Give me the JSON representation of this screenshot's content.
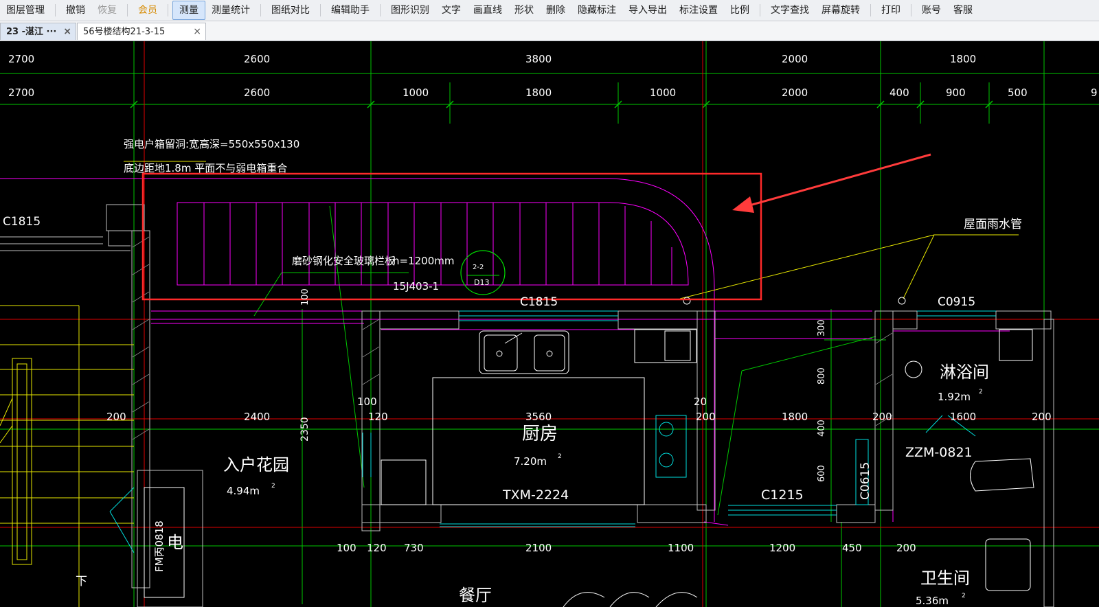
{
  "toolbar": {
    "items": [
      {
        "label": "图层管理",
        "state": "normal"
      },
      {
        "label": "撤销",
        "state": "normal"
      },
      {
        "label": "恢复",
        "state": "disabled"
      },
      {
        "label": "会员",
        "state": "vip"
      },
      {
        "label": "测量",
        "state": "active"
      },
      {
        "label": "测量统计",
        "state": "normal"
      },
      {
        "label": "图纸对比",
        "state": "normal"
      },
      {
        "label": "编辑助手",
        "state": "normal"
      },
      {
        "label": "图形识别",
        "state": "normal"
      },
      {
        "label": "文字",
        "state": "normal"
      },
      {
        "label": "画直线",
        "state": "normal"
      },
      {
        "label": "形状",
        "state": "normal"
      },
      {
        "label": "删除",
        "state": "normal"
      },
      {
        "label": "隐藏标注",
        "state": "normal"
      },
      {
        "label": "导入导出",
        "state": "normal"
      },
      {
        "label": "标注设置",
        "state": "normal"
      },
      {
        "label": "比例",
        "state": "normal"
      },
      {
        "label": "文字查找",
        "state": "normal"
      },
      {
        "label": "屏幕旋转",
        "state": "normal"
      },
      {
        "label": "打印",
        "state": "normal"
      },
      {
        "label": "账号",
        "state": "normal"
      },
      {
        "label": "客服",
        "state": "normal"
      }
    ]
  },
  "tabs": [
    {
      "label": "23 -湛江 ···",
      "close": "×"
    },
    {
      "label": "56号楼结构21-3-15",
      "close": "×"
    }
  ],
  "drawing": {
    "top_dims_row1": [
      "2700",
      "2600",
      "3800",
      "2000",
      "1800"
    ],
    "top_dims_row2": [
      "2700",
      "2600",
      "1000",
      "1800",
      "1000",
      "2000",
      "400",
      "900",
      "500",
      "9"
    ],
    "note_line1": "强电户箱留洞:宽高深=550x550x130",
    "note_line2": "底边距地1.8m   平面不与弱电箱重合",
    "railing_note": "磨砂钢化安全玻璃栏板",
    "railing_height": "h=1200mm",
    "railing_ref": "15J403-1",
    "detail_top": "2-2",
    "detail_bottom": "D13",
    "window_c1815_left": "C1815",
    "window_c1815_mid": "C1815",
    "window_c0915": "C0915",
    "rain_pipe": "屋面雨水管",
    "dim_100_vertical": "100",
    "dim_300": "300",
    "dim_800": "800",
    "dim_400": "400",
    "dim_600": "600",
    "mid_dims": [
      "200",
      "2400",
      "100",
      "120",
      "3560",
      "20",
      "200",
      "1800",
      "200",
      "1600",
      "200"
    ],
    "dim_2350": "2350",
    "garden_name": "入户花园",
    "garden_area": "4.94m",
    "kitchen_name": "厨房",
    "kitchen_area": "7.20m",
    "door_txm": "TXM-2224",
    "window_c1215": "C1215",
    "window_c0615": "C0615",
    "door_zzm": "ZZM-0821",
    "shower_name": "淋浴间",
    "shower_area": "1.92m",
    "bath_name": "卫生间",
    "bath_area": "5.36m",
    "sup": "2",
    "bottom_dims": [
      "100",
      "120",
      "730",
      "2100",
      "1100",
      "1200",
      "450",
      "200"
    ],
    "dining_name": "餐厅",
    "fm_label": "FM丙0818",
    "elec_label": "电",
    "down_label": "下"
  },
  "colors": {
    "grid_green": "#00ff00",
    "axis_red": "#ff0000",
    "magenta": "#ff00ff",
    "yellow": "#ffff00",
    "cyan": "#00ffff",
    "highlight": "#ff3030"
  }
}
